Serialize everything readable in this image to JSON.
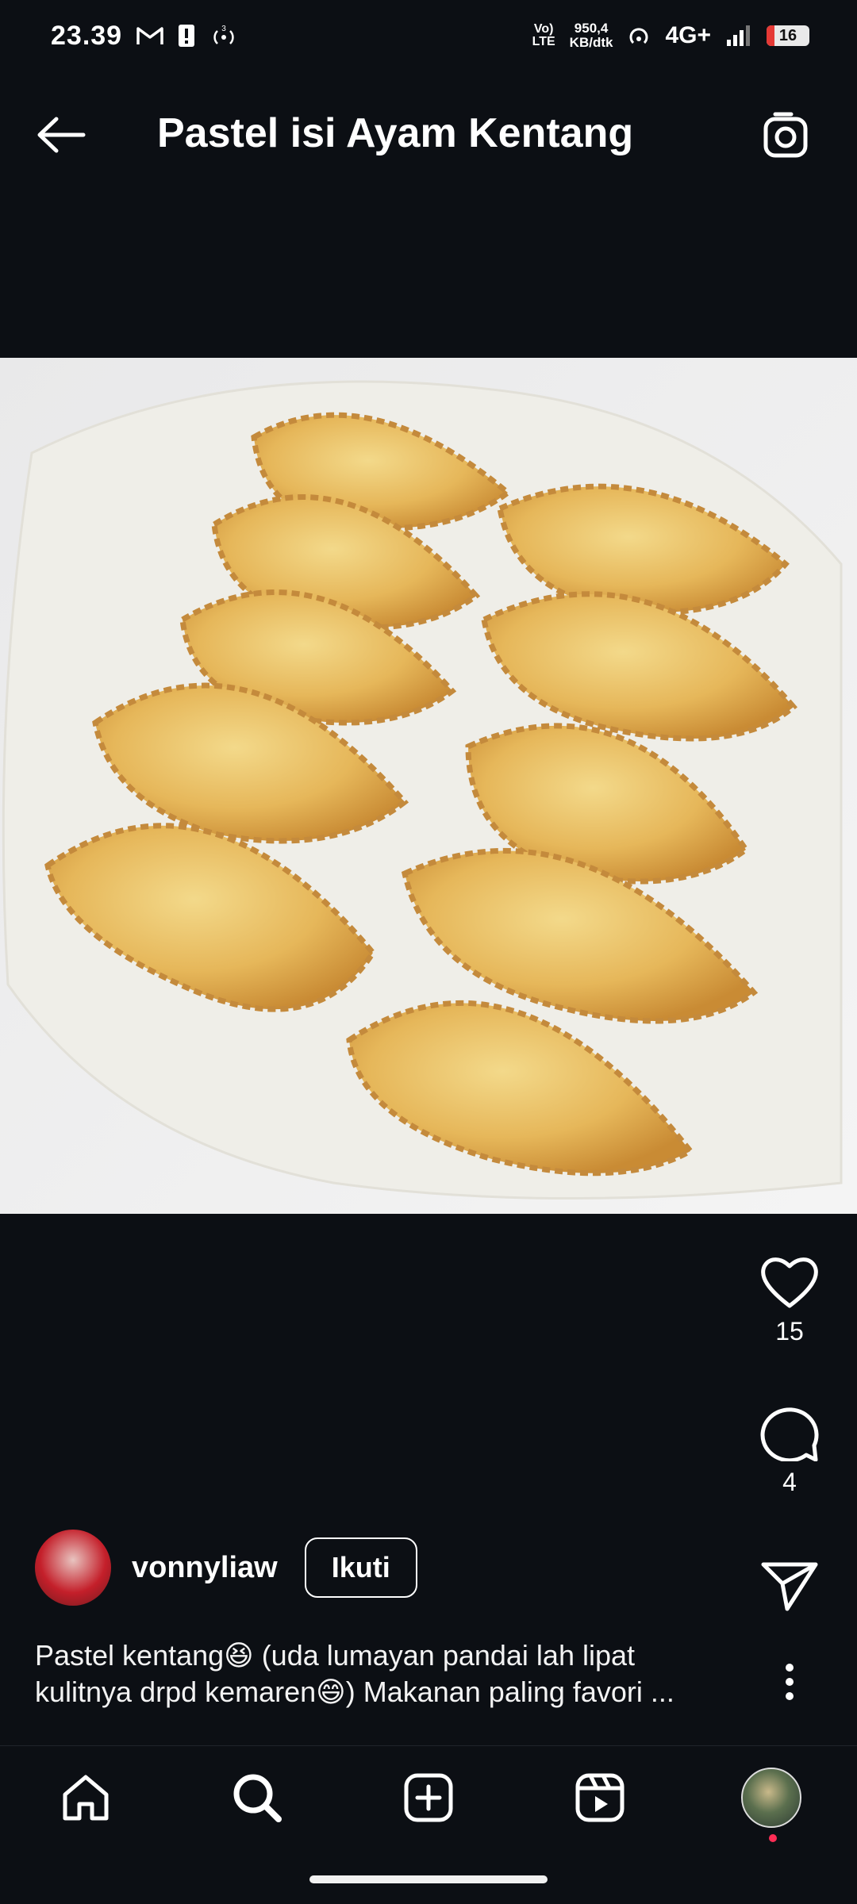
{
  "status_bar": {
    "time": "23.39",
    "volte_line1": "Vo)",
    "volte_line2": "LTE",
    "speed_line1": "950,4",
    "speed_line2": "KB/dtk",
    "network": "4G+",
    "battery": "16"
  },
  "header": {
    "title": "Pastel isi Ayam Kentang"
  },
  "post": {
    "image_alt": "Fried pastel pastries on a white plate",
    "likes": "15",
    "comments": "4",
    "author": {
      "username": "vonnyliaw",
      "follow_label": "Ikuti"
    },
    "caption_line1": "Pastel kentang😆 (uda lumayan pandai lah lipat",
    "caption_line2": "kulitnya drpd kemaren😄) Makanan paling favori ..."
  },
  "nav": {
    "items": [
      "home-icon",
      "search-icon",
      "create-icon",
      "reels-icon",
      "profile-avatar"
    ]
  },
  "colors": {
    "background": "#0c0f14",
    "text": "#ffffff",
    "notification_dot": "#ff2d55"
  }
}
